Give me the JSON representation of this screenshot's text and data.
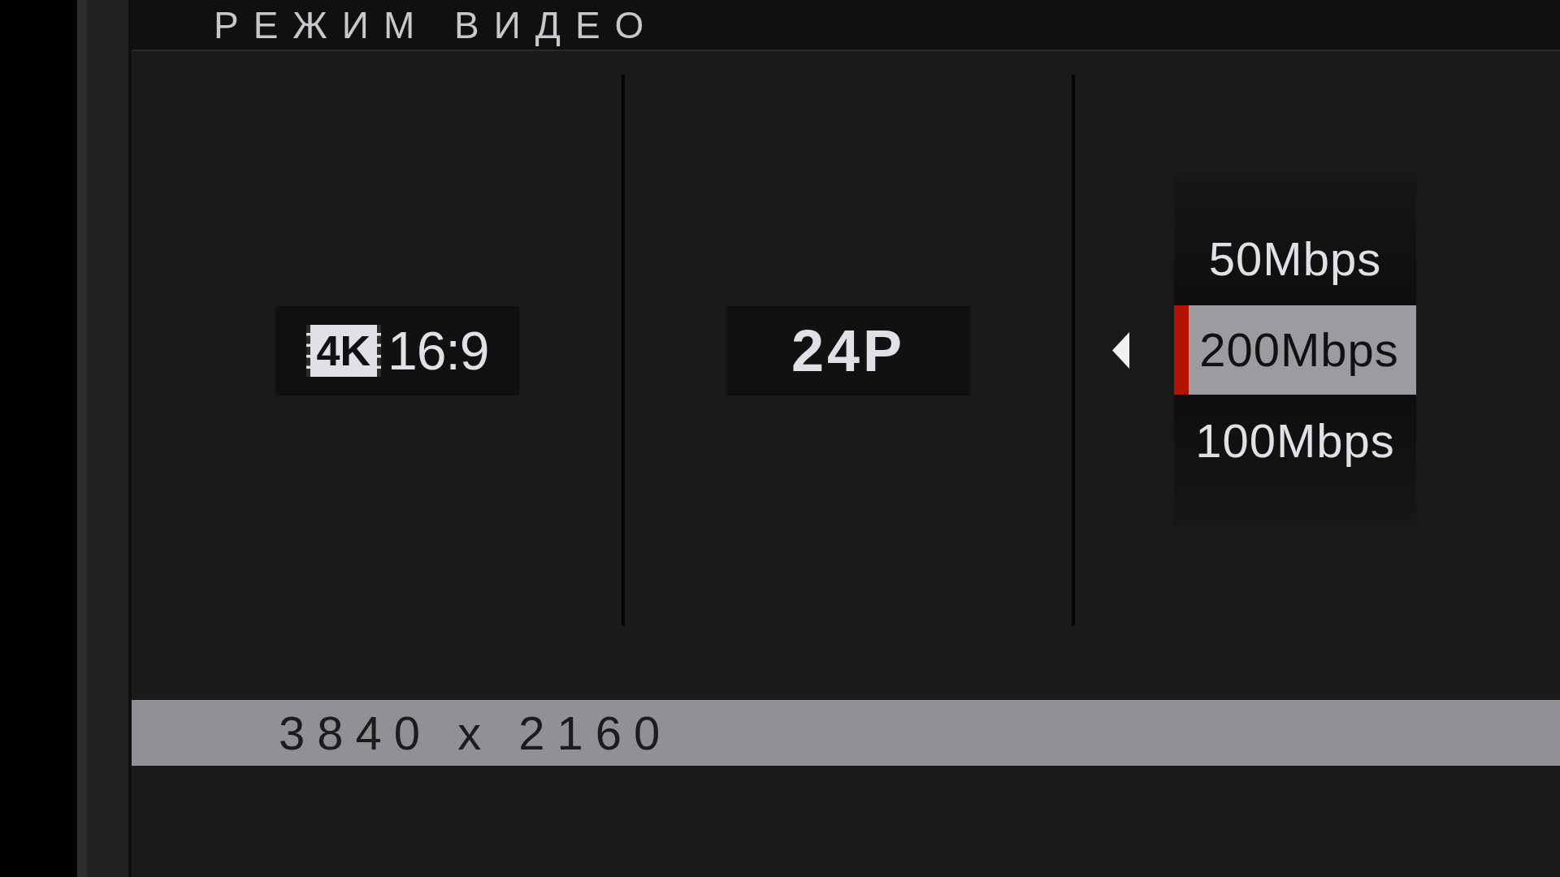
{
  "header": {
    "title": "РЕЖИМ ВИДЕО"
  },
  "columns": [
    {
      "kind": "format",
      "badge": "4K",
      "value": "16:9"
    },
    {
      "kind": "value",
      "value": "24P"
    },
    {
      "kind": "list",
      "options": [
        {
          "label": "50Mbps",
          "selected": false
        },
        {
          "label": "200Mbps",
          "selected": true
        },
        {
          "label": "100Mbps",
          "selected": false
        }
      ]
    }
  ],
  "info_bar": {
    "text": "3840 x 2160"
  }
}
